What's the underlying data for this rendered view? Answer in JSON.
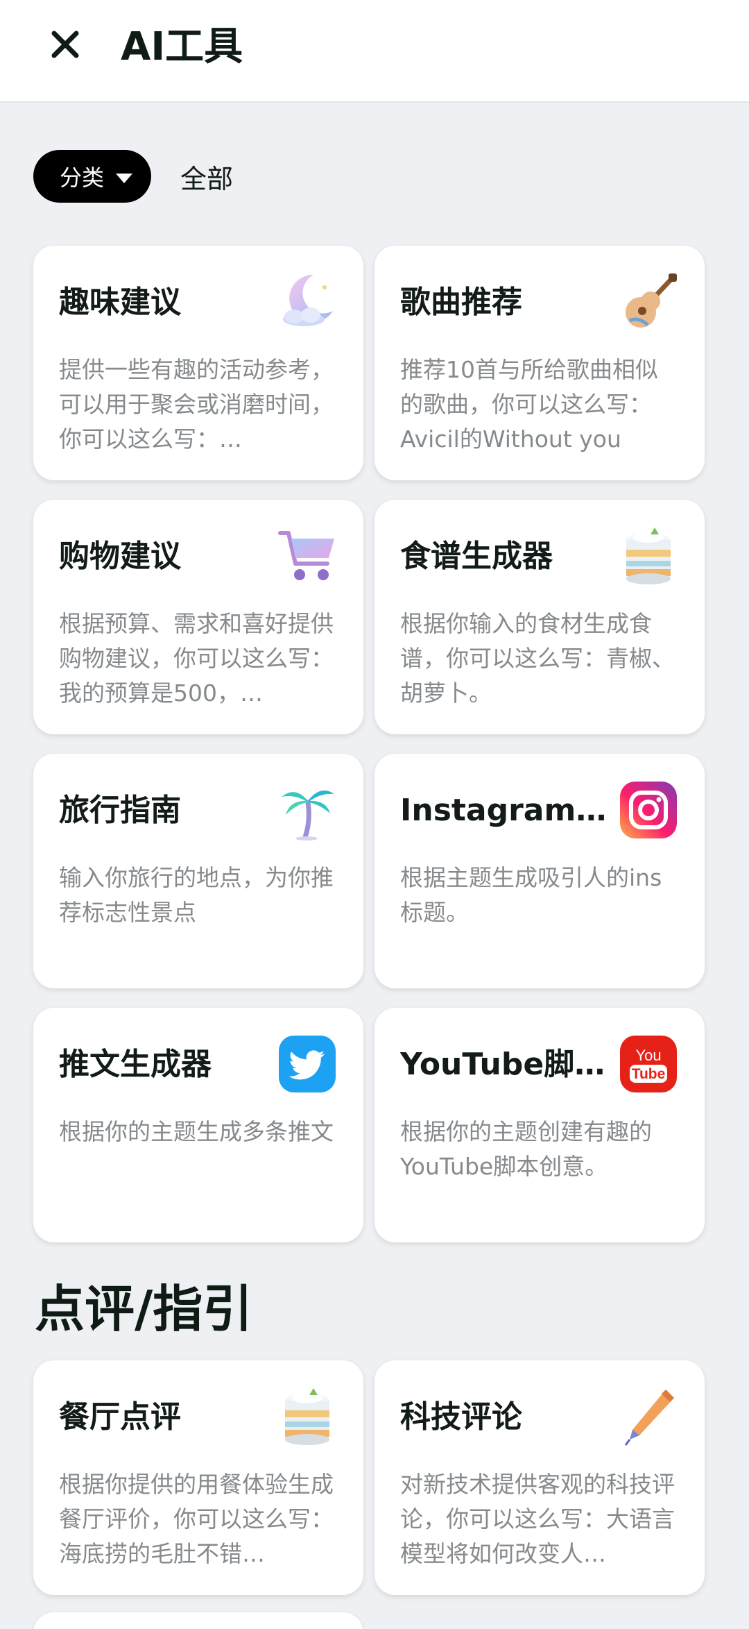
{
  "header": {
    "title": "AI工具"
  },
  "filter": {
    "chip_label": "分类",
    "all_label": "全部"
  },
  "tools": [
    {
      "title": "趣味建议",
      "desc": "提供一些有趣的活动参考，可以用于聚会或消磨时间，你可以这么写：…",
      "icon": "crescent-moon-icon"
    },
    {
      "title": "歌曲推荐",
      "desc": "推荐10首与所给歌曲相似的歌曲，你可以这么写：Avicil的Without you",
      "icon": "guitar-icon"
    },
    {
      "title": "购物建议",
      "desc": "根据预算、需求和喜好提供购物建议，你可以这么写：我的预算是500，…",
      "icon": "shopping-cart-icon"
    },
    {
      "title": "食谱生成器",
      "desc": "根据你输入的食材生成食谱，你可以这么写：青椒、胡萝卜。",
      "icon": "layer-cake-icon"
    },
    {
      "title": "旅行指南",
      "desc": "输入你旅行的地点，为你推荐标志性景点",
      "icon": "palm-tree-icon"
    },
    {
      "title": "Instagram标…",
      "desc": "根据主题生成吸引人的ins标题。",
      "icon": "instagram-icon"
    },
    {
      "title": "推文生成器",
      "desc": "根据你的主题生成多条推文",
      "icon": "twitter-icon"
    },
    {
      "title": "YouTube脚…",
      "desc": "根据你的主题创建有趣的YouTube脚本创意。",
      "icon": "youtube-icon"
    }
  ],
  "section": {
    "title": "点评/指引"
  },
  "reviews": [
    {
      "title": "餐厅点评",
      "desc": "根据你提供的用餐体验生成餐厅评价，你可以这么写：海底捞的毛肚不错…",
      "icon": "layer-cake-icon"
    },
    {
      "title": "科技评论",
      "desc": "对新技术提供客观的科技评论，你可以这么写：大语言模型将如何改变人…",
      "icon": "pen-icon"
    }
  ],
  "icon_svgs": {
    "crescent-moon-icon": "<svg viewBox='0 0 90 90' width='90' height='90'><defs><linearGradient id='mg' x1='0' y1='0' x2='1' y2='1'><stop offset='0' stop-color='#f3c8ef'/><stop offset='1' stop-color='#9fb7f2'/></linearGradient></defs><path d='M54 6 A34 34 0 1 0 82 58 A28 28 0 1 1 54 6 Z' fill='url(#mg)'/><ellipse cx='40' cy='70' rx='30' ry='10' fill='#cfd8f7'/><ellipse cx='26' cy='66' rx='14' ry='10' fill='#dfe5fb'/><ellipse cx='50' cy='64' rx='14' ry='11' fill='#e6ebfc'/><circle cx='70' cy='24' r='3' fill='#f7d46a'/></svg>",
    "guitar-icon": "<svg viewBox='0 0 90 90' width='90' height='90'><line x1='48' y1='44' x2='80' y2='10' stroke='#8a5a2b' stroke-width='7' stroke-linecap='round'/><rect x='74' y='4' width='12' height='12' rx='3' fill='#6b4220'/><circle cx='34' cy='60' r='22' fill='#e9b98a'/><circle cx='48' cy='44' r='14' fill='#e9b98a'/><circle cx='36' cy='58' r='6' fill='#7a4a24'/><path d='M18 72 Q30 66 44 78' stroke='#6aa3d8' stroke-width='5' fill='none'/></svg>",
    "shopping-cart-icon": "<svg viewBox='0 0 90 90' width='90' height='90'><defs><linearGradient id='cg' x1='0' y1='0' x2='1' y2='1'><stop offset='0' stop-color='#a8c8f7'/><stop offset='1' stop-color='#e7a6e6'/></linearGradient></defs><path d='M6 12 L18 12 L28 56 L74 56' stroke='#b58bd9' stroke-width='6' fill='none' stroke-linecap='round' stroke-linejoin='round'/><path d='M22 20 L84 20 L76 48 L28 48 Z' fill='url(#cg)'/><circle cx='34' cy='72' r='8' fill='#8c6fc9'/><circle cx='68' cy='72' r='8' fill='#8c6fc9'/></svg>",
    "layer-cake-icon": "<svg viewBox='0 0 90 90' width='90' height='90'><ellipse cx='45' cy='22' rx='32' ry='10' fill='#f4f6fa'/><rect x='13' y='22' width='64' height='56' fill='#eaf0f4'/><rect x='13' y='36' width='64' height='10' fill='#f2c87a'/><rect x='13' y='52' width='64' height='8' fill='#a9d6e4'/><rect x='13' y='64' width='64' height='10' fill='#f0b46a'/><ellipse cx='45' cy='78' rx='32' ry='8' fill='#d6dde3'/><ellipse cx='45' cy='18' rx='22' ry='8' fill='#ffffff'/><path d='M54 4 l6 10 l-12 0 z' fill='#7bbf5c'/></svg>",
    "palm-tree-icon": "<svg viewBox='0 0 90 90' width='90' height='90'><path d='M46 34 Q50 60 42 84' stroke='#9c8fd6' stroke-width='7' fill='none' stroke-linecap='round'/><path d='M46 32 Q28 10 8 26 Q28 22 46 34 Z' fill='#37c9c0'/><path d='M46 32 Q64 8 84 22 Q64 20 46 34 Z' fill='#2ab7d1'/><path d='M46 32 Q20 30 14 52 Q30 36 46 34 Z' fill='#49d2b4'/><path d='M46 32 Q72 30 78 50 Q62 36 46 34 Z' fill='#31c4c7'/><ellipse cx='44' cy='86' rx='16' ry='3' fill='#d9d3ef'/></svg>",
    "instagram-icon": "<svg viewBox='0 0 90 90' width='90' height='90'><defs><linearGradient id='ig' x1='0' y1='1' x2='1' y2='0'><stop offset='0' stop-color='#fcb045'/><stop offset='0.45' stop-color='#fd1d6d'/><stop offset='1' stop-color='#833ab4'/></linearGradient></defs><rect x='4' y='4' width='82' height='82' rx='22' fill='url(#ig)'/><rect x='20' y='20' width='50' height='50' rx='15' fill='none' stroke='#ffffff' stroke-width='6'/><circle cx='45' cy='45' r='12' fill='none' stroke='#ffffff' stroke-width='6'/><circle cx='60' cy='30' r='3.5' fill='#ffffff'/></svg>",
    "twitter-icon": "<svg viewBox='0 0 90 90' width='90' height='90'><rect x='4' y='4' width='82' height='82' rx='22' fill='#1da1f2'/><path d='M70 30c-2 1-4 1.6-6 1.9 2.2-1.3 3.8-3.4 4.6-5.8-2 1.2-4.3 2.1-6.7 2.6-1.9-2-4.7-3.3-7.7-3.3-5.8 0-10.6 4.7-10.6 10.6 0 .8.1 1.6.3 2.4-8.8-.4-16.6-4.7-21.8-11.1-.9 1.6-1.4 3.4-1.4 5.3 0 3.7 1.9 6.9 4.7 8.8-1.7-.1-3.4-.5-4.8-1.3v.1c0 5.1 3.7 9.4 8.5 10.4-.9.2-1.8.4-2.8.4-.7 0-1.3-.1-2-.2 1.3 4.2 5.3 7.3 9.9 7.4-3.6 2.8-8.2 4.5-13.2 4.5-.9 0-1.7 0-2.5-.1 4.7 3 10.3 4.8 16.2 4.8 19.5 0 30.1-16.1 30.1-30.1v-1.4c2.1-1.5 3.9-3.4 5.2-5.5z' fill='#ffffff'/></svg>",
    "youtube-icon": "<svg viewBox='0 0 90 90' width='90' height='90'><rect x='4' y='4' width='82' height='82' rx='22' fill='#e62117'/><text x='45' y='40' text-anchor='middle' font-family='Liberation Sans, sans-serif' font-size='22' fill='#ffffff'>You</text><rect x='18' y='46' width='54' height='26' rx='8' fill='#ffffff'/><text x='45' y='66' text-anchor='middle' font-family='Liberation Sans, sans-serif' font-size='21' font-weight='bold' fill='#e62117'>Tube</text></svg>",
    "pen-icon": "<svg viewBox='0 0 90 90' width='90' height='90'><path d='M70 6 L82 18 L32 72 L18 78 L22 64 Z' fill='#f2a15a'/><path d='M70 6 L82 18 L76 24 L64 12 Z' fill='#e07a3a'/><path d='M22 64 L32 72 L18 78 Z' fill='#7a84d8'/><line x1='18' y1='78' x2='12' y2='86' stroke='#5a63b8' stroke-width='3'/></svg>"
  }
}
